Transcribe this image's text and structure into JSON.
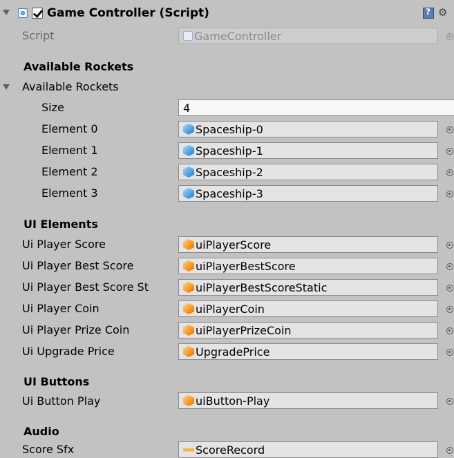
{
  "component": {
    "title": "Game Controller (Script)",
    "script_label": "Script",
    "script_value": "GameController"
  },
  "sections": {
    "rockets_header": "Available Rockets",
    "rockets_foldout": "Available Rockets",
    "size_label": "Size",
    "size_value": "4",
    "elements": [
      {
        "label": "Element 0",
        "value": "Spaceship-0"
      },
      {
        "label": "Element 1",
        "value": "Spaceship-1"
      },
      {
        "label": "Element 2",
        "value": "Spaceship-2"
      },
      {
        "label": "Element 3",
        "value": "Spaceship-3"
      }
    ],
    "ui_elements_header": "UI Elements",
    "ui_elements": [
      {
        "label": "Ui Player Score",
        "value": "uiPlayerScore"
      },
      {
        "label": "Ui Player Best Score",
        "value": "uiPlayerBestScore"
      },
      {
        "label": "Ui Player Best Score St",
        "value": "uiPlayerBestScoreStatic"
      },
      {
        "label": "Ui Player Coin",
        "value": "uiPlayerCoin"
      },
      {
        "label": "Ui Player Prize Coin",
        "value": "uiPlayerPrizeCoin"
      },
      {
        "label": "Ui Upgrade Price",
        "value": "UpgradePrice"
      }
    ],
    "ui_buttons_header": "UI Buttons",
    "ui_buttons": [
      {
        "label": "Ui Button Play",
        "value": "uiButton-Play"
      }
    ],
    "audio_header": "Audio",
    "audio": [
      {
        "label": "Score Sfx",
        "value": "ScoreRecord"
      }
    ]
  },
  "icons": {
    "foldout": "foldout-triangle-icon",
    "component": "script-icon",
    "enabled": "checkbox-icon",
    "help": "help-icon",
    "settings": "gear-icon",
    "prefab": "prefab-icon",
    "gameobject": "gameobject-icon",
    "audio": "audio-clip-icon",
    "picker": "object-picker-icon"
  }
}
